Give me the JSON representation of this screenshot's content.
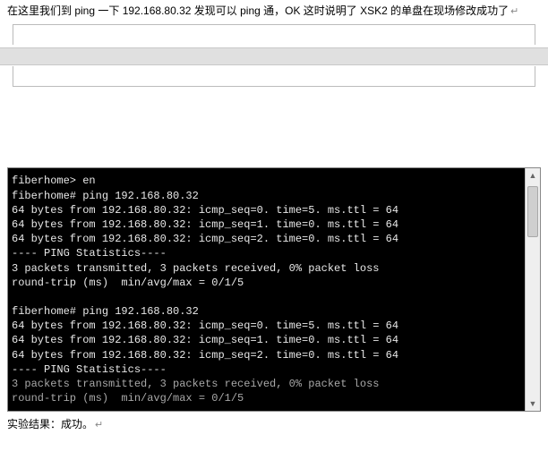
{
  "intro_text": "在这里我们到 ping 一下 192.168.80.32 发现可以 ping 通，OK 这时说明了 XSK2 的单盘在现场修改成功了",
  "paragraph_mark": "↵",
  "terminal_lines": [
    "fiberhome> en",
    "fiberhome# ping 192.168.80.32",
    "64 bytes from 192.168.80.32: icmp_seq=0. time=5. ms.ttl = 64",
    "64 bytes from 192.168.80.32: icmp_seq=1. time=0. ms.ttl = 64",
    "64 bytes from 192.168.80.32: icmp_seq=2. time=0. ms.ttl = 64",
    "---- PING Statistics----",
    "3 packets transmitted, 3 packets received, 0% packet loss",
    "round-trip (ms)  min/avg/max = 0/1/5",
    "",
    "fiberhome# ping 192.168.80.32",
    "64 bytes from 192.168.80.32: icmp_seq=0. time=5. ms.ttl = 64",
    "64 bytes from 192.168.80.32: icmp_seq=1. time=0. ms.ttl = 64",
    "64 bytes from 192.168.80.32: icmp_seq=2. time=0. ms.ttl = 64",
    "---- PING Statistics----"
  ],
  "terminal_gray_lines": [
    "3 packets transmitted, 3 packets received, 0% packet loss",
    "round-trip (ms)  min/avg/max = 0/1/5"
  ],
  "cursor_lines": [
    -1
  ],
  "result_text": "实验结果：成功。"
}
